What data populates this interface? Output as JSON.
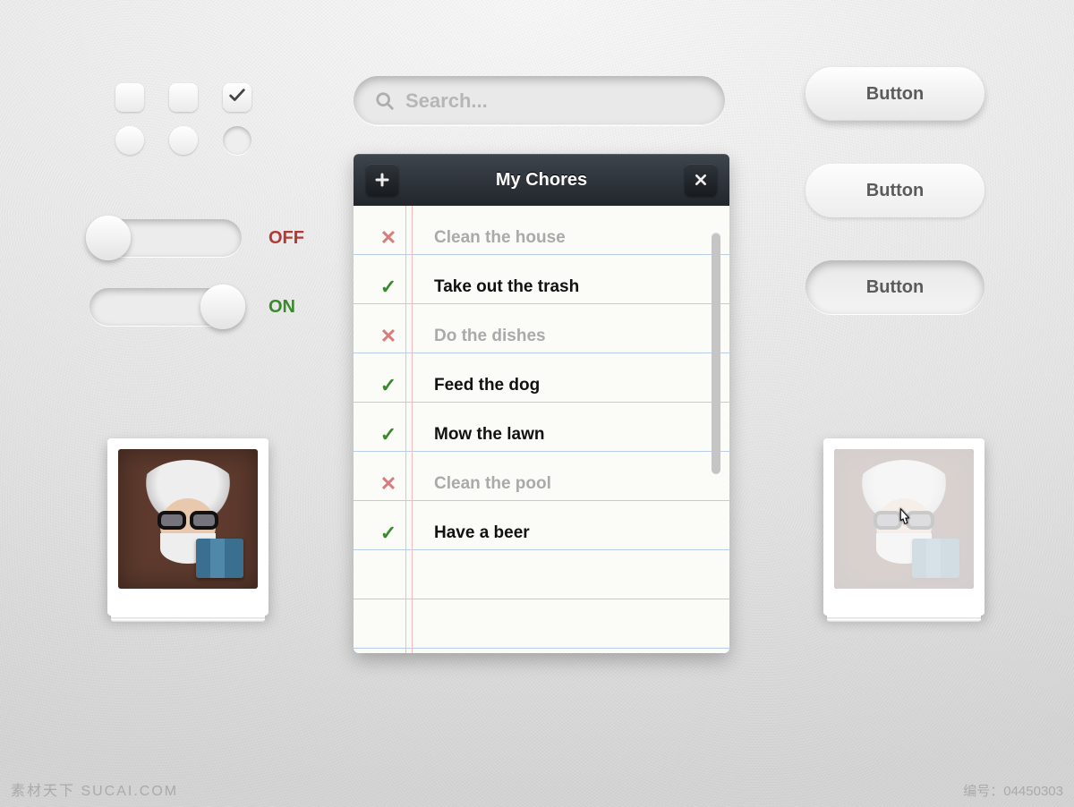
{
  "checkboxes": {
    "cb3_checked": true
  },
  "search": {
    "placeholder": "Search..."
  },
  "buttons": {
    "b1": "Button",
    "b2": "Button",
    "b3": "Button"
  },
  "sliders": {
    "off_label": "OFF",
    "on_label": "ON"
  },
  "chores": {
    "title": "My Chores",
    "items": [
      {
        "done": false,
        "text": "Clean the house"
      },
      {
        "done": true,
        "text": "Take out the trash"
      },
      {
        "done": false,
        "text": "Do the dishes"
      },
      {
        "done": true,
        "text": "Feed the dog"
      },
      {
        "done": true,
        "text": "Mow the lawn"
      },
      {
        "done": false,
        "text": "Clean the pool"
      },
      {
        "done": true,
        "text": "Have a beer"
      }
    ]
  },
  "watermark": {
    "left": "素材天下 SUCAI.COM",
    "right": "编号：04450303"
  }
}
